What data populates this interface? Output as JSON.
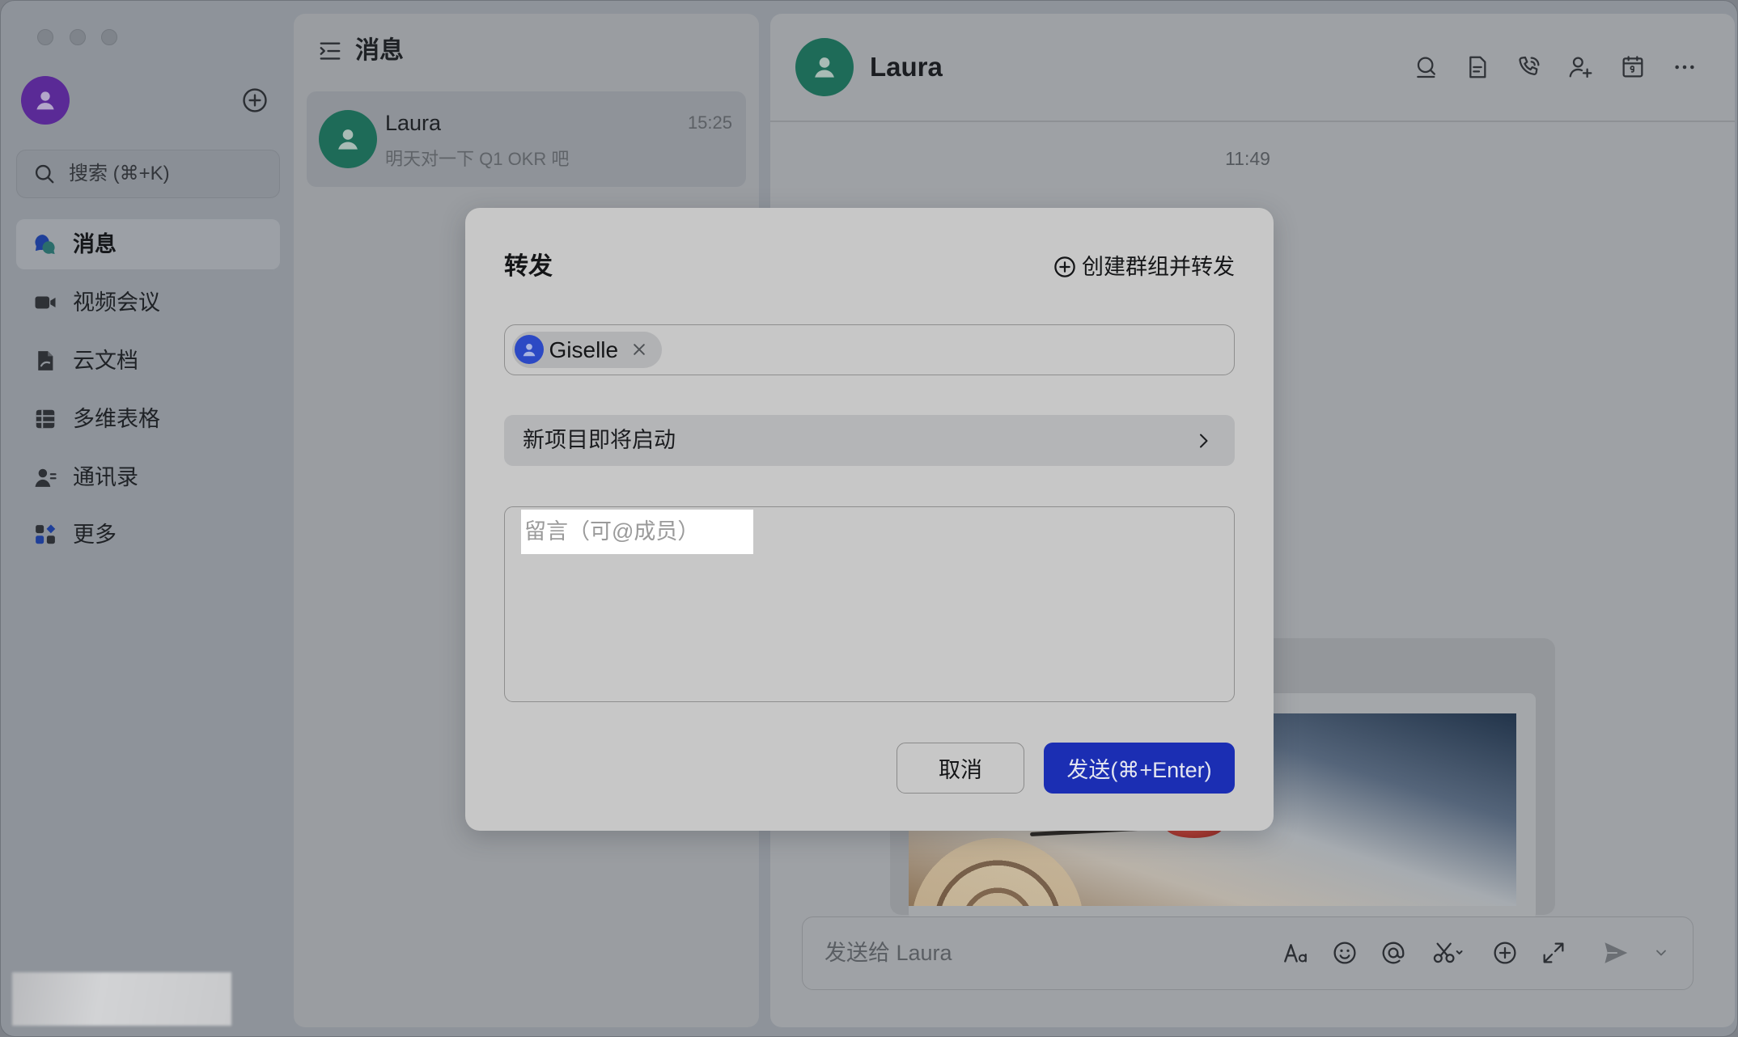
{
  "sidebar": {
    "search": {
      "placeholder": "搜索 (⌘+K)",
      "icon": "search-icon"
    },
    "items": [
      {
        "label": "消息",
        "icon": "chat-bubble-icon",
        "active": true
      },
      {
        "label": "视频会议",
        "icon": "video-camera-icon",
        "active": false
      },
      {
        "label": "云文档",
        "icon": "cloud-doc-icon",
        "active": false
      },
      {
        "label": "多维表格",
        "icon": "table-icon",
        "active": false
      },
      {
        "label": "通讯录",
        "icon": "contacts-icon",
        "active": false
      },
      {
        "label": "更多",
        "icon": "more-apps-icon",
        "active": false
      }
    ]
  },
  "message_list": {
    "title": "消息",
    "header_icon": "menu-list-icon",
    "chats": [
      {
        "name": "Laura",
        "time": "15:25",
        "preview": "明天对一下 Q1 OKR 吧",
        "selected": true
      }
    ]
  },
  "chat": {
    "name": "Laura",
    "header_icons": [
      "search-in-chat-icon",
      "doc-icon",
      "phone-call-icon",
      "add-member-icon",
      "calendar-icon",
      "more-icon"
    ],
    "messages": [
      {
        "time": "11:49"
      }
    ],
    "composer": {
      "placeholder": "发送给 Laura",
      "icons": [
        "text-format-icon",
        "emoji-icon",
        "mention-icon",
        "scissors-icon",
        "plus-circle-icon",
        "expand-icon",
        "send-icon",
        "chevron-down-icon"
      ]
    }
  },
  "forward_dialog": {
    "title": "转发",
    "create_group_label": "创建群组并转发",
    "recipients": [
      {
        "name": "Giselle"
      }
    ],
    "forwarded_item": "新项目即将启动",
    "note_placeholder": "留言（可@成员）",
    "cancel_label": "取消",
    "send_label": "发送(⌘+Enter)"
  },
  "colors": {
    "accent": "#1b2eb3",
    "chat_avatar": "#1e6b58",
    "user_avatar": "#5a2a96",
    "recipient_avatar": "#2c49c4",
    "highlight": "#ffffff"
  }
}
